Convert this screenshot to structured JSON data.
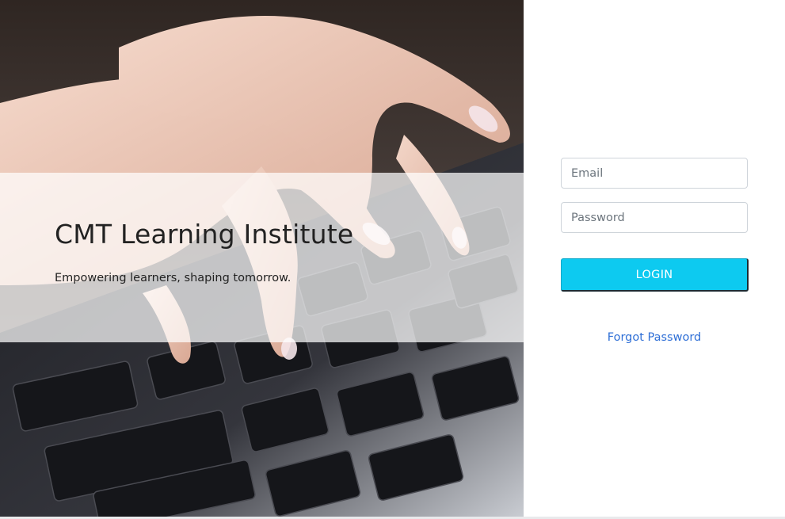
{
  "hero": {
    "title": "CMT Learning Institute",
    "tagline": "Empowering learners, shaping tomorrow.",
    "image": "hands-typing-on-keyboard"
  },
  "login_form": {
    "email_placeholder": "Email",
    "email_value": "",
    "password_placeholder": "Password",
    "password_value": "",
    "login_label": "LOGIN",
    "forgot_label": "Forgot Password"
  },
  "colors": {
    "accent": "#0dcaf0",
    "link": "#2f6fd6",
    "text": "#222222"
  }
}
